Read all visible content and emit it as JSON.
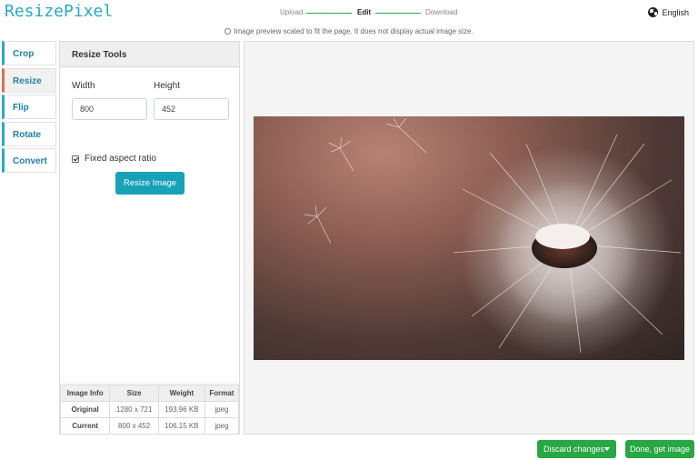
{
  "app": {
    "logo_part1": "Resize",
    "logo_part2": "Pixel"
  },
  "steps": [
    {
      "label": "Upload",
      "state": "done"
    },
    {
      "label": "Edit",
      "state": "active"
    },
    {
      "label": "Download",
      "state": "pending"
    }
  ],
  "language": {
    "label": "English",
    "icon": "globe-icon"
  },
  "notice": "Image preview scaled to fit the page. It does not display actual image size.",
  "tabs": [
    {
      "label": "Crop",
      "active": false
    },
    {
      "label": "Resize",
      "active": true
    },
    {
      "label": "Flip",
      "active": false
    },
    {
      "label": "Rotate",
      "active": false
    },
    {
      "label": "Convert",
      "active": false
    }
  ],
  "tools": {
    "title": "Resize Tools",
    "width_label": "Width",
    "width_value": "800",
    "height_label": "Height",
    "height_value": "452",
    "aspect_label": "Fixed aspect ratio",
    "aspect_checked": true,
    "resize_button": "Resize Image"
  },
  "image_info": {
    "headers": [
      "Image Info",
      "Size",
      "Weight",
      "Format"
    ],
    "rows": [
      [
        "Original",
        "1280 x 721",
        "193.96 KB",
        "jpeg"
      ],
      [
        "Current",
        "800 x 452",
        "106.15 KB",
        "jpeg"
      ]
    ]
  },
  "actions": {
    "discard": "Discard changes",
    "done": "Done, get image"
  },
  "colors": {
    "accent": "#17a2b8",
    "green": "#28a745",
    "active_tab_marker": "#e46b4f",
    "link": "#1f7fa8"
  }
}
